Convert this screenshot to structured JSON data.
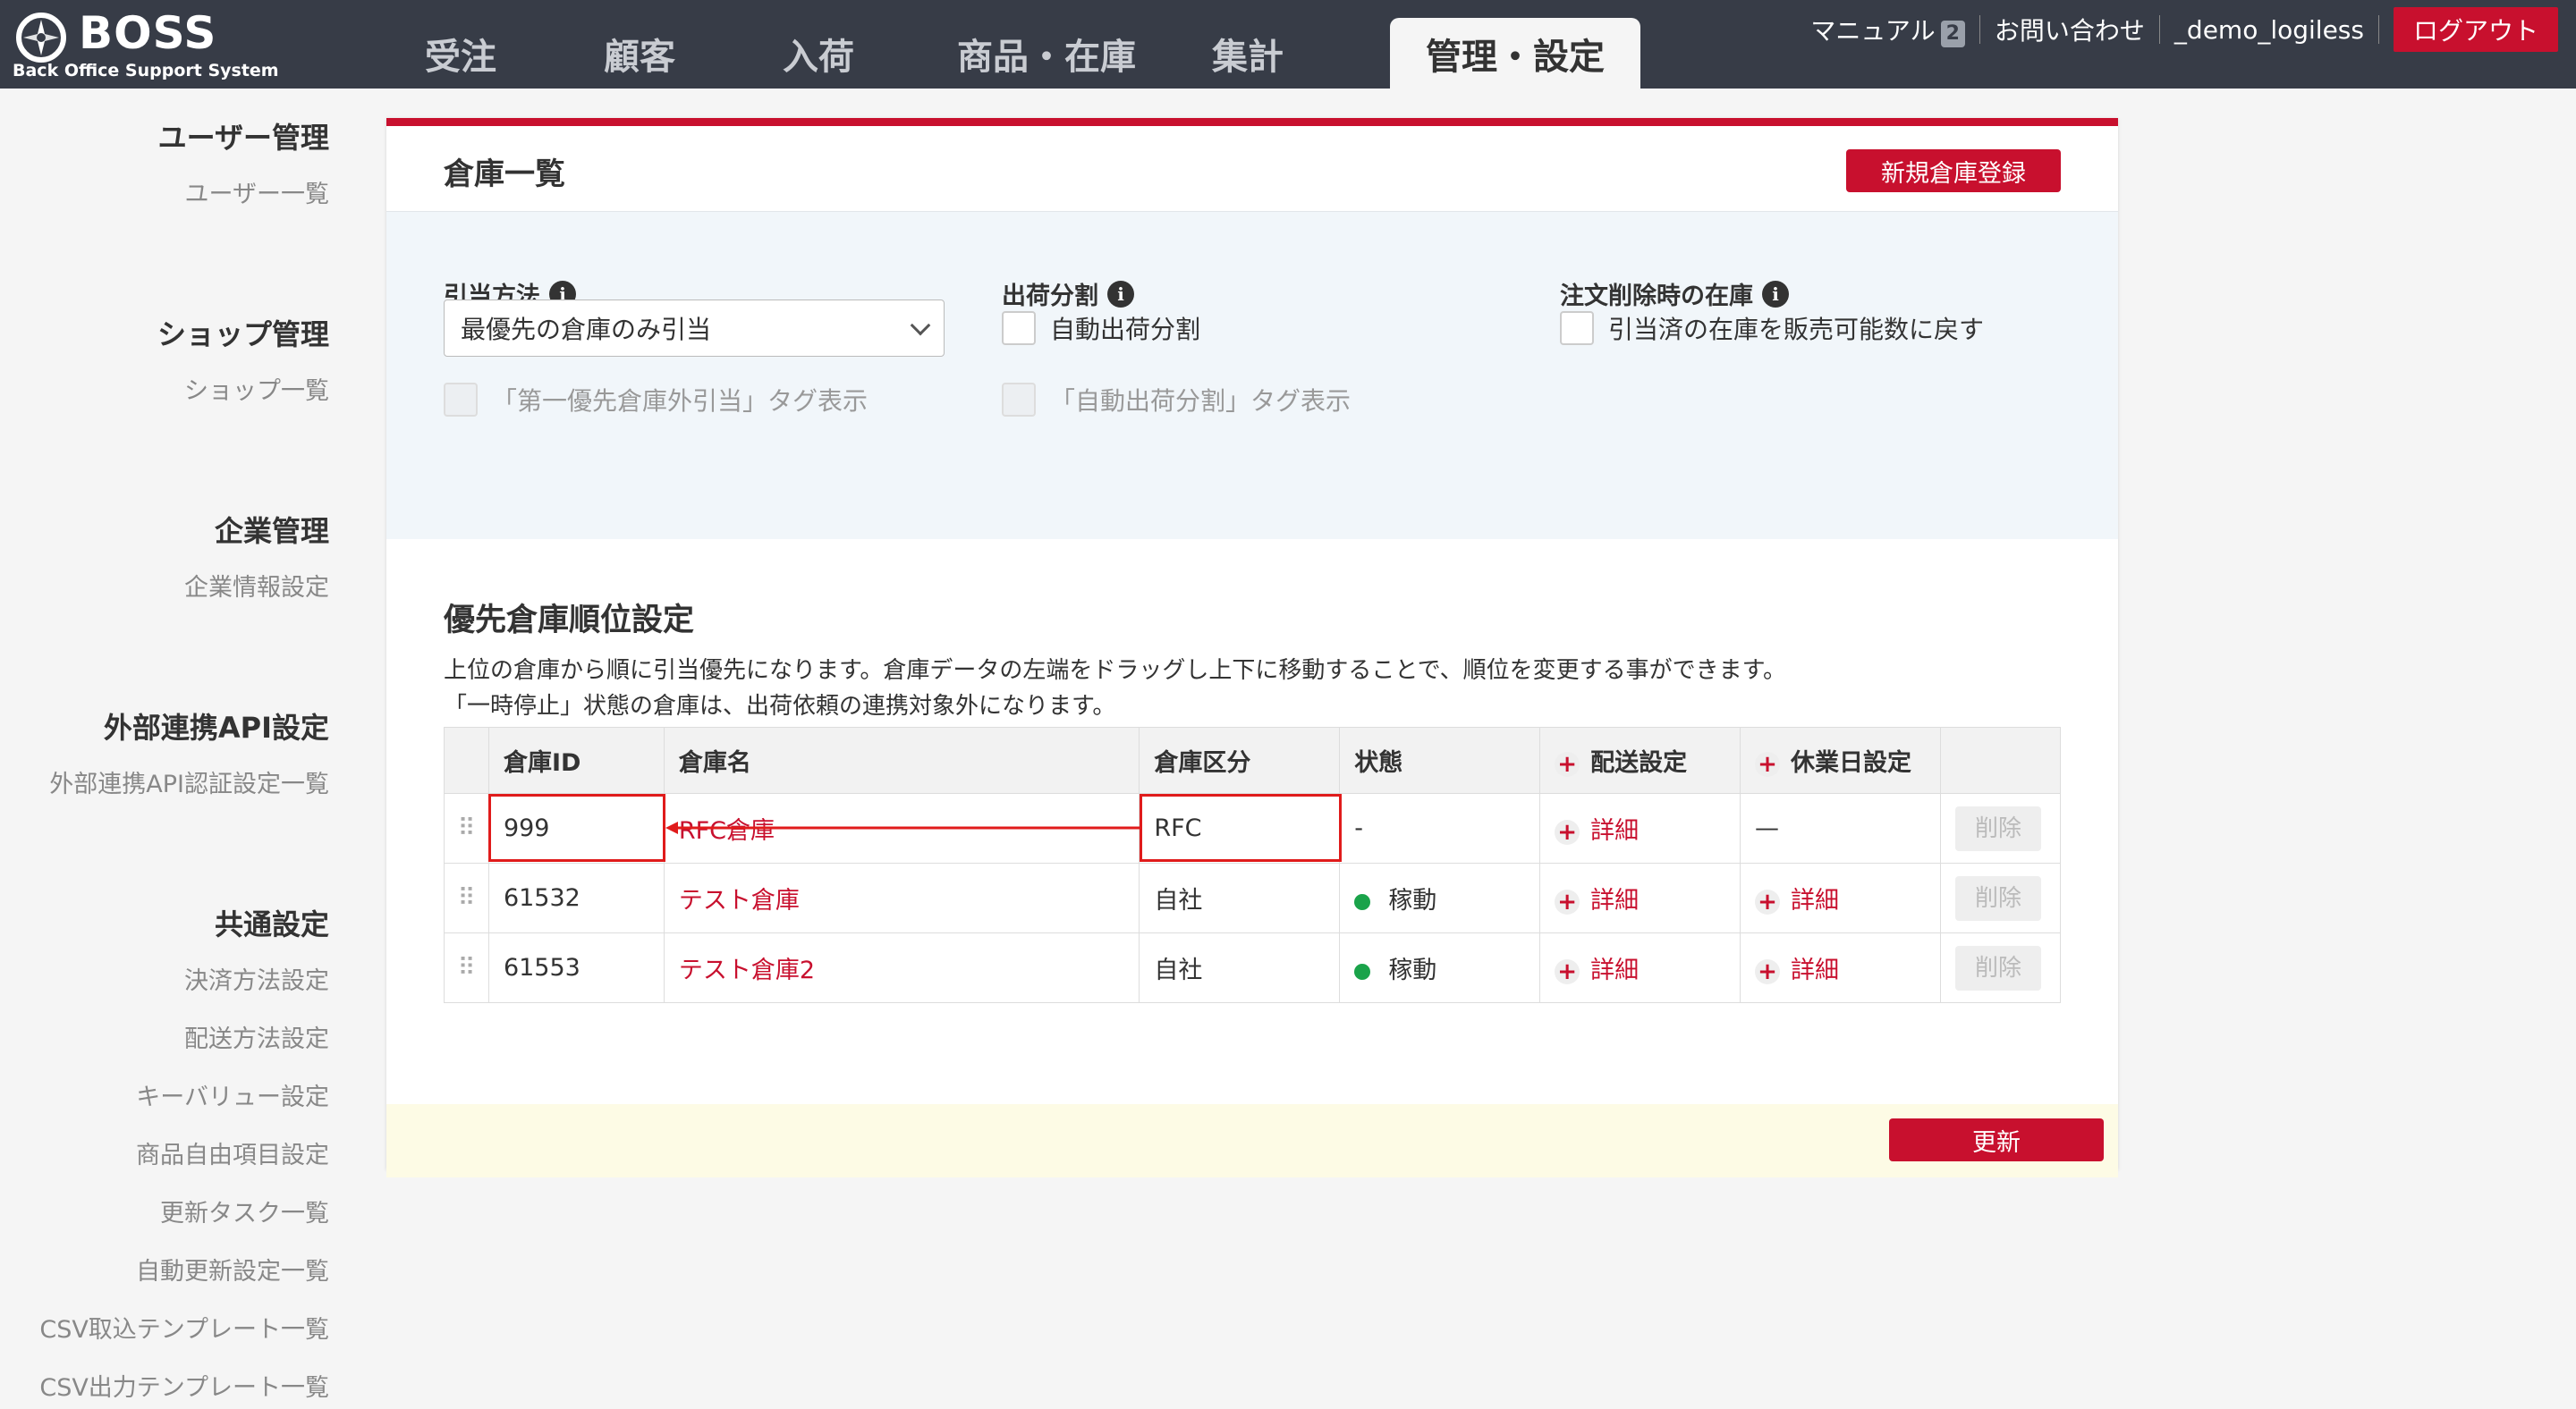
{
  "header": {
    "logo_text": "BOSS",
    "logo_sub": "Back Office Support System",
    "tabs": [
      {
        "label": "受注"
      },
      {
        "label": "顧客"
      },
      {
        "label": "入荷"
      },
      {
        "label": "商品・在庫"
      },
      {
        "label": "集計"
      },
      {
        "label": "管理・設定",
        "active": true
      }
    ],
    "manual_label": "マニュアル",
    "manual_badge": "2",
    "contact_label": "お問い合わせ",
    "user_label": "_demo_logiless",
    "logout_label": "ログアウト"
  },
  "sidebar": {
    "groups": [
      {
        "title": "ユーザー管理",
        "items": [
          "ユーザー一覧"
        ]
      },
      {
        "title": "ショップ管理",
        "items": [
          "ショップ一覧"
        ]
      },
      {
        "title": "企業管理",
        "items": [
          "企業情報設定"
        ]
      },
      {
        "title": "外部連携API設定",
        "items": [
          "外部連携API認証設定一覧"
        ]
      },
      {
        "title": "共通設定",
        "items": [
          "決済方法設定",
          "配送方法設定",
          "キーバリュー設定",
          "商品自由項目設定",
          "更新タスク一覧",
          "自動更新設定一覧",
          "CSV取込テンプレート一覧",
          "CSV出力テンプレート一覧"
        ]
      }
    ]
  },
  "panel": {
    "title": "倉庫一覧",
    "new_button": "新規倉庫登録",
    "update_button": "更新"
  },
  "settings": {
    "allocation": {
      "label": "引当方法",
      "selected": "最優先の倉庫のみ引当",
      "tag_checkbox": "「第一優先倉庫外引当」タグ表示"
    },
    "shipment_split": {
      "label": "出荷分割",
      "auto_checkbox": "自動出荷分割",
      "tag_checkbox": "「自動出荷分割」タグ表示"
    },
    "order_delete": {
      "label": "注文削除時の在庫",
      "checkbox": "引当済の在庫を販売可能数に戻す"
    }
  },
  "priority": {
    "title": "優先倉庫順位設定",
    "desc_line1": "上位の倉庫から順に引当優先になります。倉庫データの左端をドラッグし上下に移動することで、順位を変更する事ができます。",
    "desc_line2": "「一時停止」状態の倉庫は、出荷依頼の連携対象外になります。"
  },
  "table": {
    "headers": {
      "id": "倉庫ID",
      "name": "倉庫名",
      "type": "倉庫区分",
      "status": "状態",
      "shipping": "配送設定",
      "holiday": "休業日設定"
    },
    "rows": [
      {
        "id": "999",
        "name": "RFC倉庫",
        "type": "RFC",
        "status": "-",
        "shipping": "詳細",
        "holiday": "—",
        "delete": "削除"
      },
      {
        "id": "61532",
        "name": "テスト倉庫",
        "type": "自社",
        "status": "稼動",
        "shipping": "詳細",
        "holiday": "詳細",
        "delete": "削除"
      },
      {
        "id": "61553",
        "name": "テスト倉庫2",
        "type": "自社",
        "status": "稼動",
        "shipping": "詳細",
        "holiday": "詳細",
        "delete": "削除"
      }
    ]
  },
  "colors": {
    "accent": "#c8102e",
    "header_bg": "#373c47",
    "status_active": "#1aa34a"
  }
}
